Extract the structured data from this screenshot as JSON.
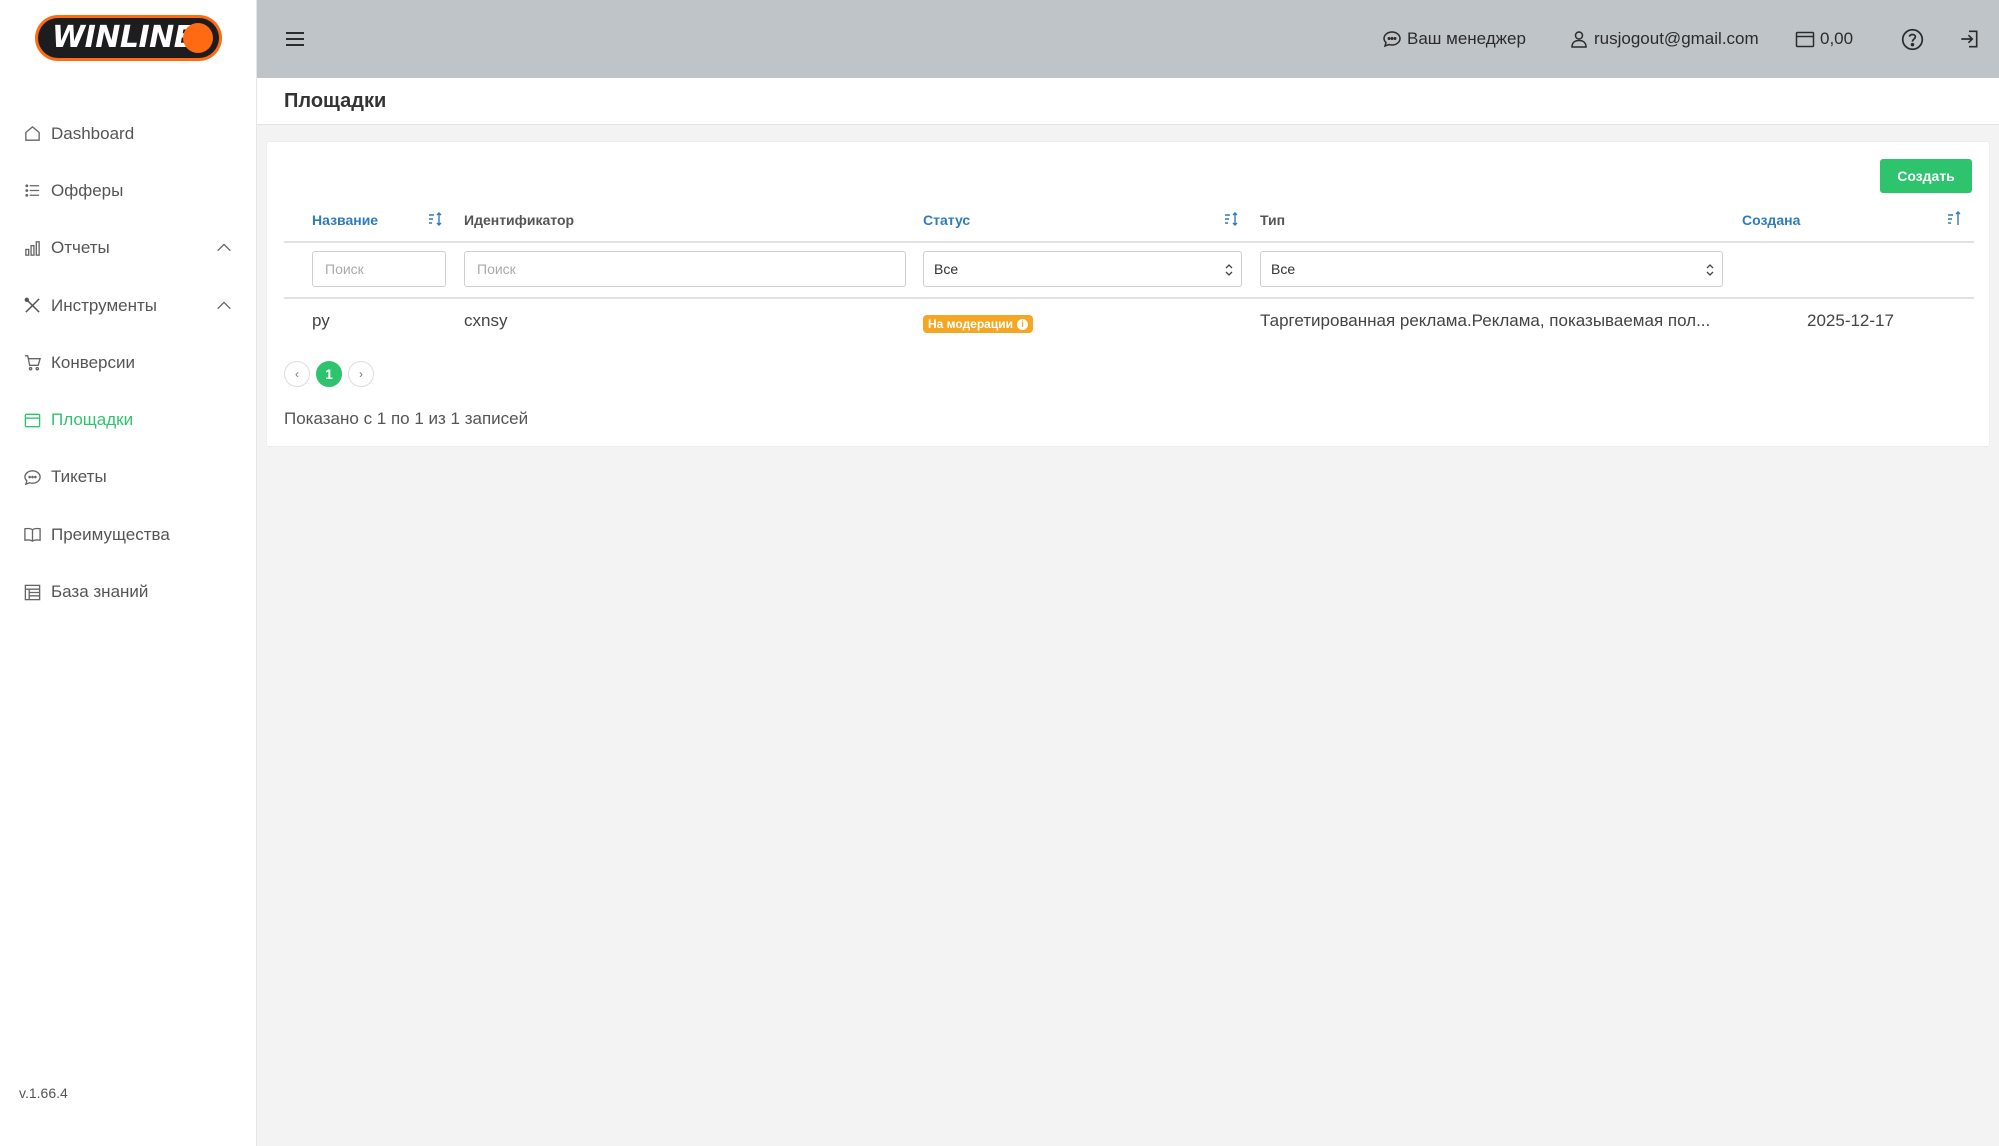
{
  "brand": {
    "logo_text": "WINLINE",
    "accent": "#ff6a13",
    "green": "#2ec46e"
  },
  "sidebar": {
    "items": [
      {
        "label": "Dashboard",
        "icon": "home-icon"
      },
      {
        "label": "Офферы",
        "icon": "list-icon"
      },
      {
        "label": "Отчеты",
        "icon": "bar-chart-icon",
        "expanded": true
      },
      {
        "label": "Инструменты",
        "icon": "tools-icon",
        "expanded": true
      },
      {
        "label": "Конверсии",
        "icon": "cart-icon"
      },
      {
        "label": "Площадки",
        "icon": "window-icon",
        "active": true
      },
      {
        "label": "Тикеты",
        "icon": "chat-icon"
      },
      {
        "label": "Преимущества",
        "icon": "book-icon"
      },
      {
        "label": "База знаний",
        "icon": "table-icon"
      }
    ],
    "version": "v.1.66.4"
  },
  "topbar": {
    "manager_label": "Ваш менеджер",
    "user_email": "rusjogout@gmail.com",
    "balance": "0,00"
  },
  "page": {
    "title": "Площадки"
  },
  "toolbar": {
    "create_label": "Создать"
  },
  "table": {
    "columns": [
      {
        "label": "Название",
        "sortable": true
      },
      {
        "label": "Идентификатор",
        "sortable": false
      },
      {
        "label": "Статус",
        "sortable": true
      },
      {
        "label": "Тип",
        "sortable": false
      },
      {
        "label": "Создана",
        "sortable": true
      }
    ],
    "filters": {
      "name_placeholder": "Поиск",
      "id_placeholder": "Поиск",
      "status_value": "Все",
      "type_value": "Все"
    },
    "rows": [
      {
        "name": "ру",
        "identifier": "cxnsy",
        "status": "На модерации",
        "type": "Таргетированная реклама.Реклама, показываемая пол...",
        "created": "2025-12-17"
      }
    ]
  },
  "pagination": {
    "prev": "‹",
    "current": "1",
    "next": "›"
  },
  "summary": "Показано с 1 по 1 из 1 записей"
}
